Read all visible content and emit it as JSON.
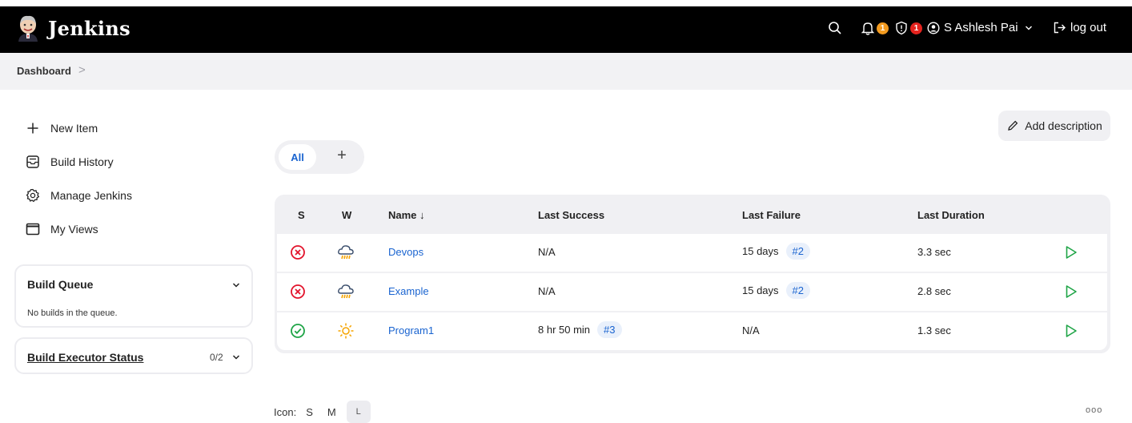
{
  "header": {
    "brand": "Jenkins",
    "notifications_count": "1",
    "security_count": "1",
    "user_name": "S Ashlesh Pai",
    "logout_label": "log out",
    "colors": {
      "bar": "#000000",
      "notification_badge": "#f29a1f",
      "security_badge": "#e4231e"
    }
  },
  "breadcrumb": {
    "dashboard": "Dashboard",
    "separator": ">"
  },
  "sidebar": {
    "items": [
      {
        "label": "New Item",
        "icon": "plus-icon"
      },
      {
        "label": "Build History",
        "icon": "inbox-icon"
      },
      {
        "label": "Manage Jenkins",
        "icon": "gear-icon"
      },
      {
        "label": "My Views",
        "icon": "window-icon"
      }
    ],
    "build_queue": {
      "title": "Build Queue",
      "empty_text": "No builds in the queue."
    },
    "executor": {
      "title": "Build Executor Status",
      "count": "0/2"
    }
  },
  "views": {
    "active_tab": "All",
    "add_label": "+"
  },
  "actions": {
    "add_description": "Add description"
  },
  "table": {
    "headers": {
      "status": "S",
      "weather": "W",
      "name": "Name ↓",
      "last_success": "Last Success",
      "last_failure": "Last Failure",
      "last_duration": "Last Duration"
    },
    "rows": [
      {
        "status": "failed",
        "weather": "storm",
        "name": "Devops",
        "last_success": "N/A",
        "last_success_build": "",
        "last_failure": "15 days",
        "last_failure_build": "#2",
        "duration": "3.3 sec"
      },
      {
        "status": "failed",
        "weather": "storm",
        "name": "Example",
        "last_success": "N/A",
        "last_success_build": "",
        "last_failure": "15 days",
        "last_failure_build": "#2",
        "duration": "2.8 sec"
      },
      {
        "status": "success",
        "weather": "sunny",
        "name": "Program1",
        "last_success": "8 hr 50 min",
        "last_success_build": "#3",
        "last_failure": "N/A",
        "last_failure_build": "",
        "duration": "1.3 sec"
      }
    ]
  },
  "icon_size": {
    "label": "Icon:",
    "small": "S",
    "medium": "M",
    "large": "L",
    "selected": "L"
  },
  "footer": {
    "more": "ooo"
  }
}
